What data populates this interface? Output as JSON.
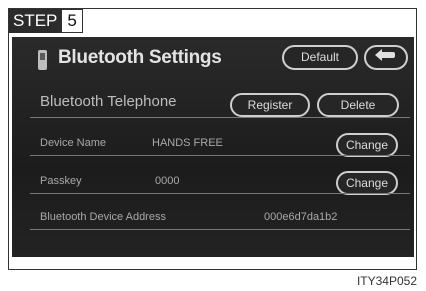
{
  "step": {
    "label": "STEP",
    "number": "5"
  },
  "screen": {
    "title": "Bluetooth Settings",
    "default_button": "Default",
    "back_icon": "back-arrow-icon",
    "section_title": "Bluetooth Telephone",
    "register_button": "Register",
    "delete_button": "Delete",
    "rows": [
      {
        "label": "Device Name",
        "value": "HANDS FREE",
        "button": "Change"
      },
      {
        "label": "Passkey",
        "value": "0000",
        "button": "Change"
      },
      {
        "label": "Bluetooth Device Address",
        "value": "000e6d7da1b2"
      }
    ]
  },
  "caption": "ITY34P052"
}
